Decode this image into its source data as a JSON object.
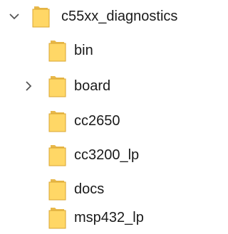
{
  "tree": {
    "root": {
      "name": "c55xx_diagnostics",
      "state": "expanded",
      "chevron_icon": "chevron-down-icon",
      "icon": "folder-icon"
    },
    "children": [
      {
        "name": "bin",
        "icon": "folder-icon",
        "expandable": false
      },
      {
        "name": "board",
        "icon": "folder-icon",
        "expandable": true,
        "chevron_icon": "chevron-right-icon"
      },
      {
        "name": "cc2650",
        "icon": "folder-icon",
        "expandable": false
      },
      {
        "name": "cc3200_lp",
        "icon": "folder-icon",
        "expandable": false
      },
      {
        "name": "docs",
        "icon": "folder-icon",
        "expandable": false
      },
      {
        "name": "msp432_lp",
        "icon": "folder-icon",
        "expandable": false
      }
    ]
  },
  "colors": {
    "folder_body": "#FFD766",
    "folder_back": "#E8B84A",
    "folder_edge": "#D9A632",
    "chevron": "#555555",
    "text": "#1A1A1A",
    "background": "#FFFFFF"
  }
}
